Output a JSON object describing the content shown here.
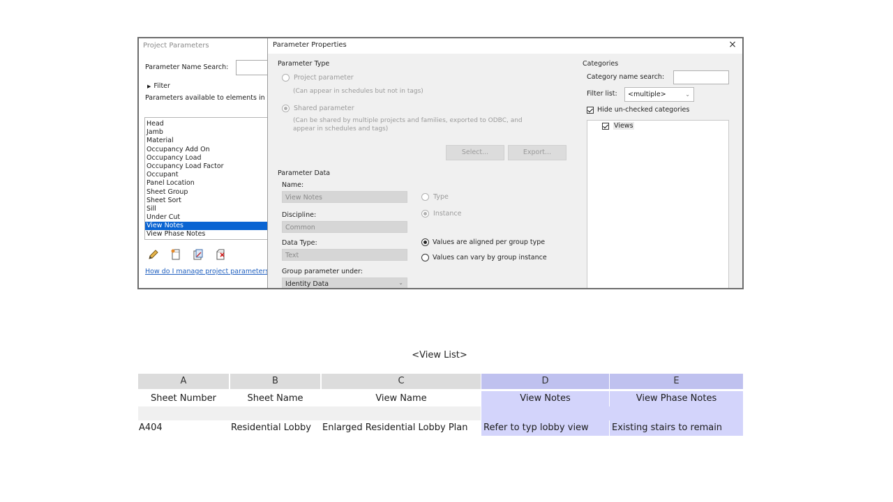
{
  "project_parameters": {
    "title": "Project Parameters",
    "search_label": "Parameter Name Search:",
    "search_value": "",
    "filter_label": "Filter",
    "available_label": "Parameters available to elements in this",
    "items": [
      "Head",
      "Jamb",
      "Material",
      "Occupancy Add On",
      "Occupancy Load",
      "Occupancy Load Factor",
      "Occupant",
      "Panel Location",
      "Sheet Group",
      "Sheet Sort",
      "Sill",
      "Under Cut",
      "View Notes",
      "View Phase Notes"
    ],
    "selected_item": "View Notes",
    "help_link": "How do I manage project parameters?"
  },
  "parameter_properties": {
    "title": "Parameter Properties",
    "close_glyph": "×",
    "parameter_type": {
      "heading": "Parameter Type",
      "project_label": "Project parameter",
      "project_desc": "(Can appear in schedules but not in tags)",
      "shared_label": "Shared parameter",
      "shared_desc_line1": "(Can be shared by multiple projects and families, exported to ODBC, and",
      "shared_desc_line2": "appear in schedules and tags)",
      "select_button": "Select...",
      "export_button": "Export..."
    },
    "parameter_data": {
      "heading": "Parameter Data",
      "name_label": "Name:",
      "name_value": "View Notes",
      "discipline_label": "Discipline:",
      "discipline_value": "Common",
      "data_type_label": "Data Type:",
      "data_type_value": "Text",
      "group_label": "Group parameter under:",
      "group_value": "Identity Data",
      "type_label": "Type",
      "instance_label": "Instance",
      "aligned_label": "Values are aligned per group type",
      "vary_label": "Values can vary by group instance"
    },
    "categories": {
      "heading": "Categories",
      "search_label": "Category name search:",
      "search_value": "",
      "filter_label": "Filter list:",
      "filter_value": "<multiple>",
      "hide_label": "Hide un-checked categories",
      "tree_items": [
        "Views"
      ]
    }
  },
  "schedule": {
    "title": "<View List>",
    "column_letters": [
      "A",
      "B",
      "C",
      "D",
      "E"
    ],
    "column_names": [
      "Sheet Number",
      "Sheet Name",
      "View Name",
      "View Notes",
      "View Phase Notes"
    ],
    "rows": [
      [
        "A404",
        "Residential Lobby",
        "Enlarged Residential Lobby Plan",
        "Refer to typ lobby view",
        "Existing stairs to remain"
      ]
    ],
    "highlight_color": "#d3d4fb",
    "highlight_header_color": "#bfc1ef"
  }
}
